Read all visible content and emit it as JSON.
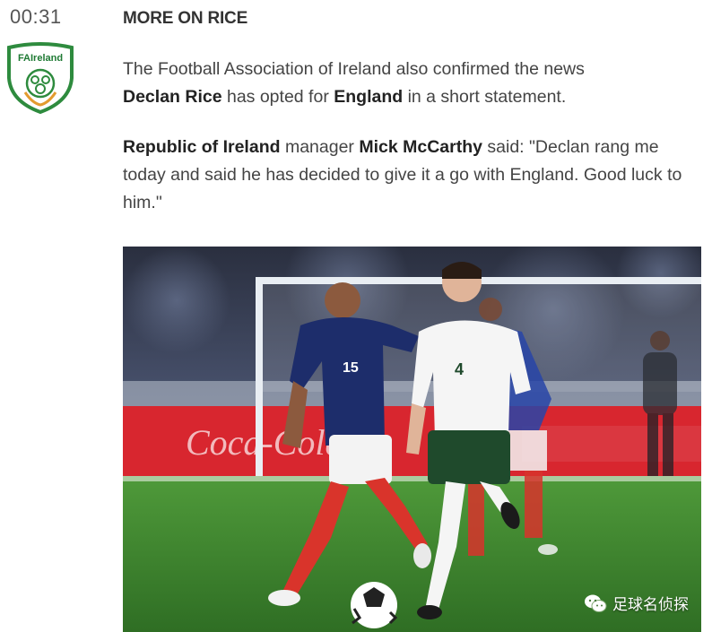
{
  "post": {
    "time": "00:31",
    "heading": "MORE ON RICE",
    "crest_text": "FAIreland",
    "paragraph1": {
      "t1": "The Football Association of Ireland also confirmed the news",
      "b1": "Declan Rice",
      "t2": " has opted for ",
      "b2": "England",
      "t3": " in a short statement."
    },
    "paragraph2": {
      "b1": "Republic of Ireland",
      "t1": " manager ",
      "b2": "Mick McCarthy",
      "t2": " said: \"Declan rang me today and said he has decided to give it a go with England. Good luck to him.\""
    }
  },
  "photo": {
    "player_left_number": "15",
    "player_right_number": "4",
    "sponsor_board": "Coca-Cola",
    "watermark": "足球名侦探"
  }
}
